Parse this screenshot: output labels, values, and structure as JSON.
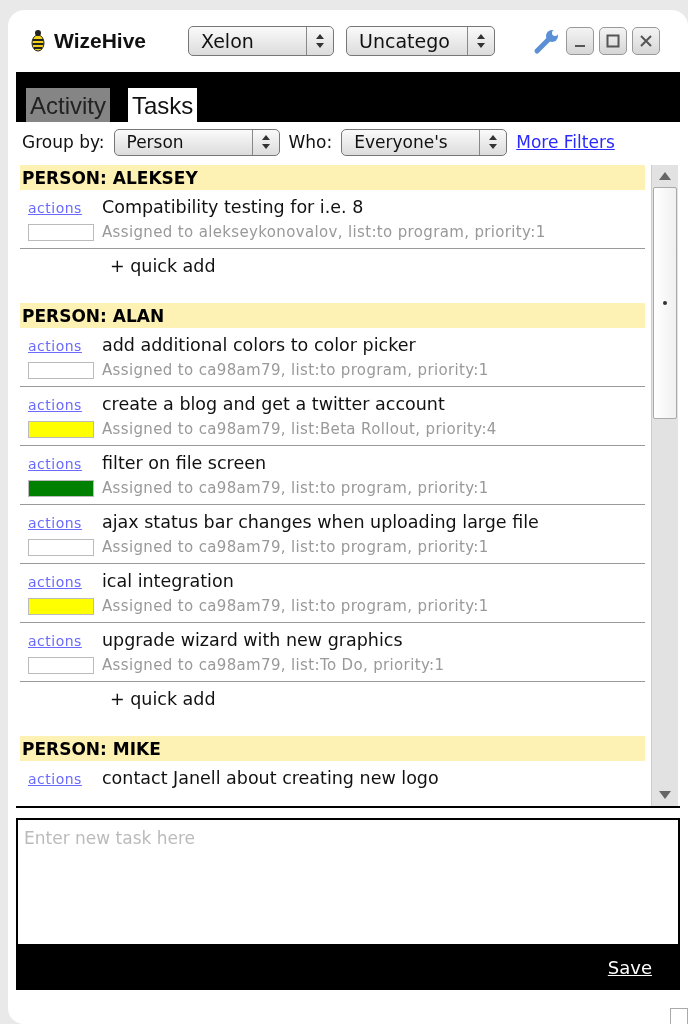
{
  "app": {
    "name": "WizeHive"
  },
  "header_selects": [
    {
      "value": "Xelon"
    },
    {
      "value": "Uncatego"
    }
  ],
  "tabs": [
    {
      "label": "Activity",
      "selected": false
    },
    {
      "label": "Tasks",
      "selected": true
    }
  ],
  "filters": {
    "group_by_label": "Group by:",
    "group_by": "Person",
    "who_label": "Who:",
    "who": "Everyone's",
    "more_filters": "More Filters"
  },
  "groups": [
    {
      "title": "PERSON: ALEKSEY",
      "tasks": [
        {
          "actions": "actions",
          "title": "Compatibility testing for i.e. 8",
          "meta": "Assigned to alekseykonovalov, list:to program, priority:1",
          "color": "#ffffff"
        }
      ],
      "quick_add": "+ quick add"
    },
    {
      "title": "PERSON: ALAN",
      "tasks": [
        {
          "actions": "actions",
          "title": "add additional colors to color picker",
          "meta": "Assigned to ca98am79, list:to program, priority:1",
          "color": "#ffffff"
        },
        {
          "actions": "actions",
          "title": "create a blog and get a twitter account",
          "meta": "Assigned to ca98am79, list:Beta Rollout, priority:4",
          "color": "#ffff00"
        },
        {
          "actions": "actions",
          "title": "filter on file screen",
          "meta": "Assigned to ca98am79, list:to program, priority:1",
          "color": "#008000"
        },
        {
          "actions": "actions",
          "title": "ajax status bar changes when uploading large file",
          "meta": "Assigned to ca98am79, list:to program, priority:1",
          "color": "#ffffff"
        },
        {
          "actions": "actions",
          "title": "ical integration",
          "meta": "Assigned to ca98am79, list:to program, priority:1",
          "color": "#ffff00"
        },
        {
          "actions": "actions",
          "title": "upgrade wizard with new graphics",
          "meta": "Assigned to ca98am79, list:To Do, priority:1",
          "color": "#ffffff"
        }
      ],
      "quick_add": "+ quick add"
    },
    {
      "title": "PERSON: MIKE",
      "tasks": [
        {
          "actions": "actions",
          "title": "contact Janell about creating new logo"
        }
      ]
    }
  ],
  "new_task": {
    "placeholder": "Enter new task here"
  },
  "save": "Save"
}
